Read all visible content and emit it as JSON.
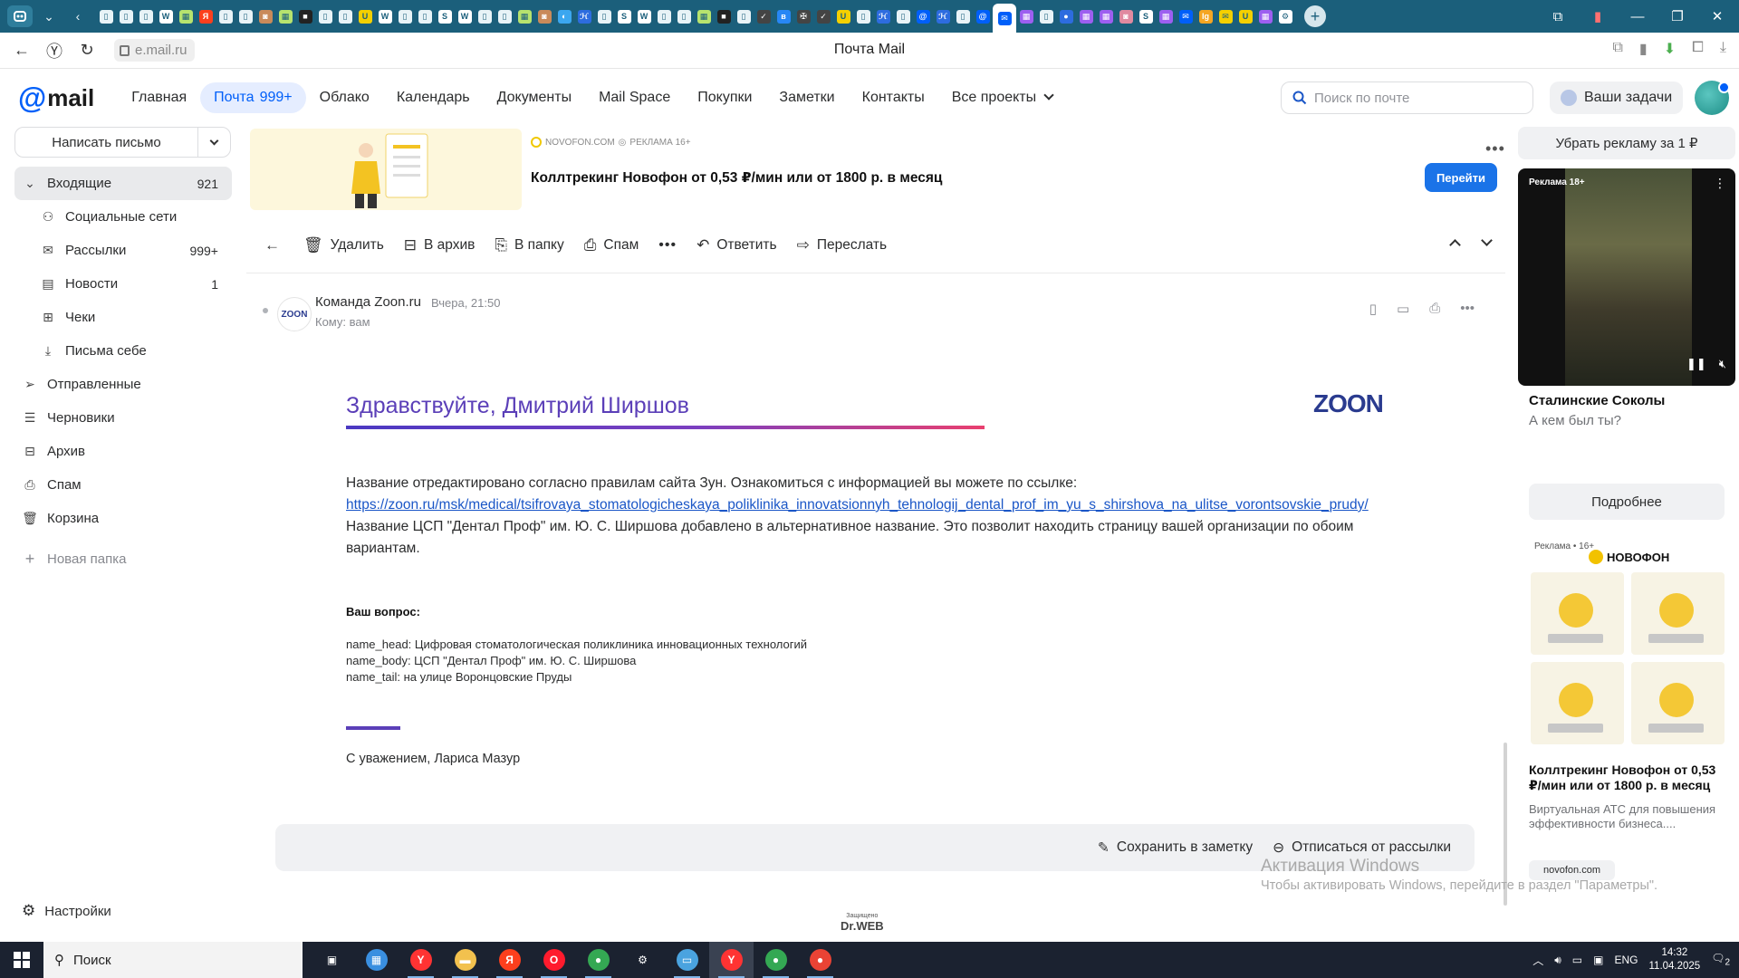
{
  "browser": {
    "address": "e.mail.ru",
    "page_title": "Почта Mail",
    "tabs": [
      {
        "icon": "page-icon",
        "color": "#e8f3f7"
      },
      {
        "icon": "page-icon",
        "color": "#e8f3f7"
      },
      {
        "icon": "page-icon",
        "color": "#e8f3f7"
      },
      {
        "icon": "wiki-icon",
        "color": "#ffffff"
      },
      {
        "icon": "grid-icon",
        "color": "#b7e36e"
      },
      {
        "icon": "yandex-icon",
        "color": "#fc3f1d"
      },
      {
        "icon": "page-icon",
        "color": "#e8f3f7"
      },
      {
        "icon": "page-icon",
        "color": "#e8f3f7"
      },
      {
        "icon": "photo-icon",
        "color": "#c98a5a"
      },
      {
        "icon": "grid-icon",
        "color": "#b7e36e"
      },
      {
        "icon": "dark-icon",
        "color": "#222222"
      },
      {
        "icon": "page-icon",
        "color": "#e8f3f7"
      },
      {
        "icon": "page-icon",
        "color": "#e8f3f7"
      },
      {
        "icon": "u-icon",
        "color": "#f4d000"
      },
      {
        "icon": "wiki-icon",
        "color": "#ffffff"
      },
      {
        "icon": "page-icon",
        "color": "#e8f3f7"
      },
      {
        "icon": "page-icon",
        "color": "#e8f3f7"
      },
      {
        "icon": "s-icon",
        "color": "#ffffff"
      },
      {
        "icon": "wiki-icon",
        "color": "#ffffff"
      },
      {
        "icon": "page-icon",
        "color": "#e8f3f7"
      },
      {
        "icon": "page-icon",
        "color": "#e8f3f7"
      },
      {
        "icon": "grid-icon",
        "color": "#b7e36e"
      },
      {
        "icon": "photo-icon",
        "color": "#c98a5a"
      },
      {
        "icon": "circle-icon",
        "color": "#3ba7f0"
      },
      {
        "icon": "hh-icon",
        "color": "#2d6cdf"
      },
      {
        "icon": "page-icon",
        "color": "#e8f3f7"
      },
      {
        "icon": "s-icon",
        "color": "#ffffff"
      },
      {
        "icon": "wiki-icon",
        "color": "#ffffff"
      },
      {
        "icon": "page-icon",
        "color": "#e8f3f7"
      },
      {
        "icon": "page-icon",
        "color": "#e8f3f7"
      },
      {
        "icon": "grid-icon",
        "color": "#b7e36e"
      },
      {
        "icon": "dark-icon",
        "color": "#222222"
      },
      {
        "icon": "page-icon",
        "color": "#e8f3f7"
      },
      {
        "icon": "check-icon",
        "color": "#444444"
      },
      {
        "icon": "vk-icon",
        "color": "#2787f5"
      },
      {
        "icon": "eagle-icon",
        "color": "#444444"
      },
      {
        "icon": "check-icon",
        "color": "#444444"
      },
      {
        "icon": "u-icon",
        "color": "#f4d000"
      },
      {
        "icon": "page-icon",
        "color": "#e8f3f7"
      },
      {
        "icon": "hh-icon",
        "color": "#2d6cdf"
      },
      {
        "icon": "page-icon",
        "color": "#e8f3f7"
      },
      {
        "icon": "at-icon",
        "color": "#005ff9"
      },
      {
        "icon": "hh-icon",
        "color": "#2d6cdf"
      },
      {
        "icon": "page-icon",
        "color": "#e8f3f7"
      },
      {
        "icon": "at-icon",
        "color": "#005ff9"
      },
      {
        "icon": "mail-icon",
        "color": "#005ff9"
      },
      {
        "icon": "grid-icon",
        "color": "#9d5ff0"
      },
      {
        "icon": "page-icon",
        "color": "#e8f3f7"
      },
      {
        "icon": "pin-icon",
        "color": "#2d6cdf"
      },
      {
        "icon": "grid-icon",
        "color": "#9d5ff0"
      },
      {
        "icon": "grid-icon",
        "color": "#9d5ff0"
      },
      {
        "icon": "photo-icon",
        "color": "#e08aa0"
      },
      {
        "icon": "s-icon",
        "color": "#ffffff"
      },
      {
        "icon": "grid-icon",
        "color": "#9d5ff0"
      },
      {
        "icon": "mail-icon",
        "color": "#005ff9"
      },
      {
        "icon": "ig-icon",
        "color": "#f5a623"
      },
      {
        "icon": "mail-icon",
        "color": "#f4d000"
      },
      {
        "icon": "u-icon",
        "color": "#f4d000"
      },
      {
        "icon": "grid-icon",
        "color": "#9d5ff0"
      },
      {
        "icon": "gear-icon",
        "color": "#ffffff"
      }
    ]
  },
  "header": {
    "logo_text": "mail",
    "nav": [
      {
        "label": "Главная"
      },
      {
        "label": "Почта",
        "badge": "999+"
      },
      {
        "label": "Облако"
      },
      {
        "label": "Календарь"
      },
      {
        "label": "Документы"
      },
      {
        "label": "Mail Space"
      },
      {
        "label": "Покупки"
      },
      {
        "label": "Заметки"
      },
      {
        "label": "Контакты"
      },
      {
        "label": "Все проекты"
      }
    ],
    "search_placeholder": "Поиск по почте",
    "tasks_label": "Ваши задачи"
  },
  "sidebar": {
    "compose_label": "Написать письмо",
    "folders": [
      {
        "label": "Входящие",
        "count": "921",
        "icon": "chevron-down-icon",
        "level": 0
      },
      {
        "label": "Социальные сети",
        "count": "",
        "icon": "people-icon",
        "level": 1
      },
      {
        "label": "Рассылки",
        "count": "999+",
        "icon": "newsletter-icon",
        "level": 1
      },
      {
        "label": "Новости",
        "count": "1",
        "icon": "news-icon",
        "level": 1
      },
      {
        "label": "Чеки",
        "count": "",
        "icon": "receipt-icon",
        "level": 1
      },
      {
        "label": "Письма себе",
        "count": "",
        "icon": "self-mail-icon",
        "level": 1
      },
      {
        "label": "Отправленные",
        "count": "",
        "icon": "sent-icon",
        "level": 0
      },
      {
        "label": "Черновики",
        "count": "",
        "icon": "draft-icon",
        "level": 0
      },
      {
        "label": "Архив",
        "count": "",
        "icon": "archive-icon",
        "level": 0
      },
      {
        "label": "Спам",
        "count": "",
        "icon": "spam-icon",
        "level": 0
      },
      {
        "label": "Корзина",
        "count": "",
        "icon": "trash-icon",
        "level": 0
      }
    ],
    "new_folder_label": "Новая папка",
    "settings_label": "Настройки"
  },
  "ad_banner": {
    "source": "NOVOFON.COM",
    "marker": "РЕКЛАМА 16+",
    "title": "Коллтрекинг Новофон от 0,53 ₽/мин или от 1800 р. в месяц",
    "button": "Перейти"
  },
  "toolbar": {
    "delete": "Удалить",
    "archive": "В архив",
    "to_folder": "В папку",
    "spam": "Спам",
    "reply": "Ответить",
    "forward": "Переслать"
  },
  "message": {
    "sender_avatar": "ZOON",
    "sender": "Команда Zoon.ru",
    "time": "Вчера, 21:50",
    "to": "Кому: вам",
    "greeting": "Здравствуйте, Дмитрий Ширшов",
    "brand_logo": "ZOON",
    "para1": "Название отредактировано согласно правилам сайта Зун. Ознакомиться с информацией вы можете по ссылке:",
    "link": "https://zoon.ru/msk/medical/tsifrovaya_stomatologicheskaya_poliklinika_innovatsionnyh_tehnologij_dental_prof_im_yu_s_shirshova_na_ulitse_vorontsovskie_prudy/",
    "para2": "Название ЦСП \"Дентал Проф\" им. Ю. С. Ширшова добавлено в альтернативное название. Это позволит находить страницу вашей организации по обоим вариантам.",
    "question_title": "Ваш вопрос:",
    "question_lines": [
      "name_head: Цифровая стоматологическая поликлиника инновационных технологий",
      "name_body: ЦСП \"Дентал Проф\" им. Ю. С. Ширшова",
      "name_tail: на улице Воронцовские Пруды"
    ],
    "regards": "С уважением, Лариса Мазур"
  },
  "bottom_actions": {
    "save_note": "Сохранить в заметку",
    "unsubscribe": "Отписаться от рассылки"
  },
  "right_column": {
    "remove_ads": "Убрать рекламу за 1 ₽",
    "video_label": "Реклама 18+",
    "video_title": "Сталинские Соколы",
    "video_sub": "А кем был ты?",
    "video_more": "Подробнее",
    "ad2_label": "Реклама • 16+",
    "ad2_brand": "НОВОФОН",
    "ad2_title": "Коллтрекинг Новофон от 0,53 ₽/мин или от 1800 р. в месяц",
    "ad2_desc": "Виртуальная АТС для повышения эффективности бизнеса....",
    "ad2_site": "novofon.com"
  },
  "watermark": {
    "line1": "Активация Windows",
    "line2": "Чтобы активировать Windows, перейдите в раздел \"Параметры\"."
  },
  "drweb": {
    "line1": "Защищено",
    "line2": "Dr.WEB"
  },
  "taskbar": {
    "search_label": "Поиск",
    "apps": [
      {
        "icon": "task-view-icon",
        "color": "#ffffff",
        "glyph": "▣"
      },
      {
        "icon": "store-icon",
        "color": "#3a8fe0",
        "glyph": "▦"
      },
      {
        "icon": "yandex-browser-icon",
        "color": "#ff3333",
        "glyph": "Y"
      },
      {
        "icon": "folder-icon",
        "color": "#f2c14e",
        "glyph": "▬"
      },
      {
        "icon": "yandex-icon",
        "color": "#fc3f1d",
        "glyph": "Я"
      },
      {
        "icon": "opera-icon",
        "color": "#ff1b2d",
        "glyph": "O"
      },
      {
        "icon": "chrome-icon",
        "color": "#34a853",
        "glyph": "●"
      },
      {
        "icon": "settings-icon",
        "color": "#ffffff",
        "glyph": "⚙"
      },
      {
        "icon": "window-icon",
        "color": "#4aa3df",
        "glyph": "▭"
      },
      {
        "icon": "yandex-browser-icon",
        "color": "#ff3333",
        "glyph": "Y"
      },
      {
        "icon": "chrome-icon",
        "color": "#34a853",
        "glyph": "●"
      },
      {
        "icon": "chrome-icon",
        "color": "#ea4335",
        "glyph": "●"
      }
    ],
    "lang": "ENG",
    "time": "14:32",
    "date": "11.04.2025",
    "notif_count": "2"
  }
}
